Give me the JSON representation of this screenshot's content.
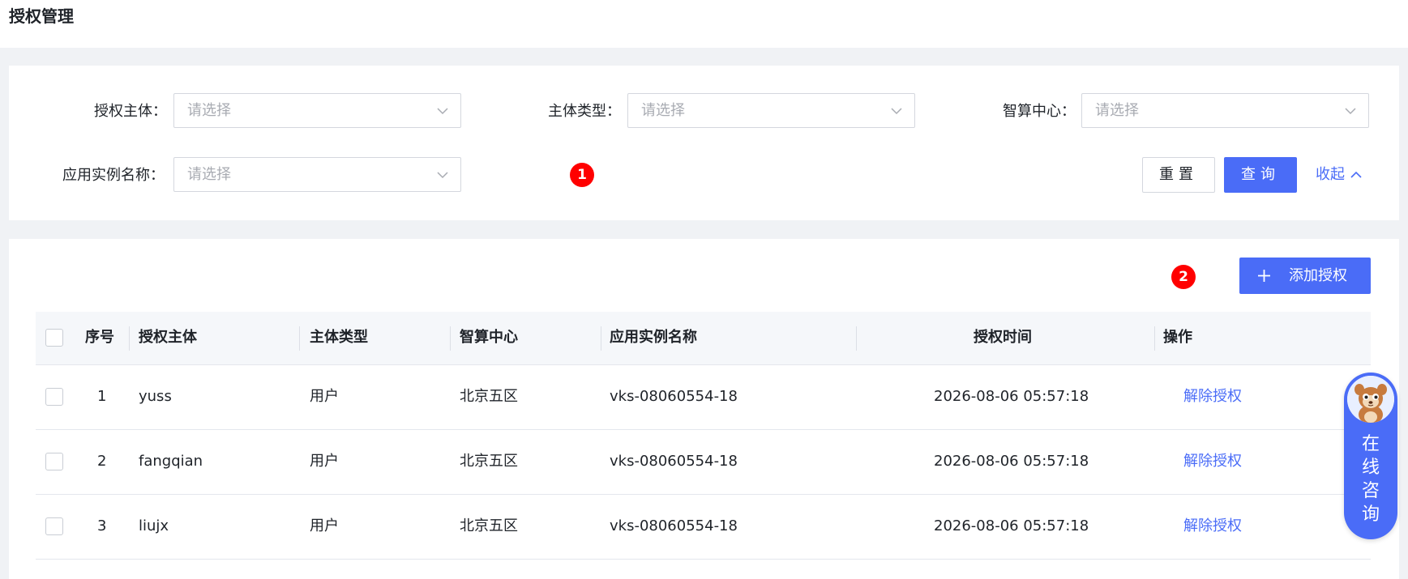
{
  "page": {
    "title": "授权管理"
  },
  "filters": {
    "subject_label": "授权主体：",
    "subject_placeholder": "请选择",
    "type_label": "主体类型：",
    "type_placeholder": "请选择",
    "center_label": "智算中心：",
    "center_placeholder": "请选择",
    "instance_label": "应用实例名称：",
    "instance_placeholder": "请选择",
    "reset_label": "重置",
    "query_label": "查询",
    "collapse_label": "收起"
  },
  "badges": {
    "first": "1",
    "second": "2"
  },
  "toolbar": {
    "add_label": "添加授权"
  },
  "table": {
    "headers": {
      "index": "序号",
      "subject": "授权主体",
      "type": "主体类型",
      "center": "智算中心",
      "instance": "应用实例名称",
      "time": "授权时间",
      "action": "操作"
    },
    "rows": [
      {
        "index": "1",
        "subject": "yuss",
        "type": "用户",
        "center": "北京五区",
        "instance": "vks-08060554-18",
        "time": "2026-08-06 05:57:18",
        "action": "解除授权"
      },
      {
        "index": "2",
        "subject": "fangqian",
        "type": "用户",
        "center": "北京五区",
        "instance": "vks-08060554-18",
        "time": "2026-08-06 05:57:18",
        "action": "解除授权"
      },
      {
        "index": "3",
        "subject": "liujx",
        "type": "用户",
        "center": "北京五区",
        "instance": "vks-08060554-18",
        "time": "2026-08-06 05:57:18",
        "action": "解除授权"
      }
    ]
  },
  "consult": {
    "label_1": "在",
    "label_2": "线",
    "label_3": "咨",
    "label_4": "询"
  },
  "colors": {
    "primary": "#4a6cf7",
    "badge": "#ff0000",
    "background": "#f0f2f5"
  }
}
